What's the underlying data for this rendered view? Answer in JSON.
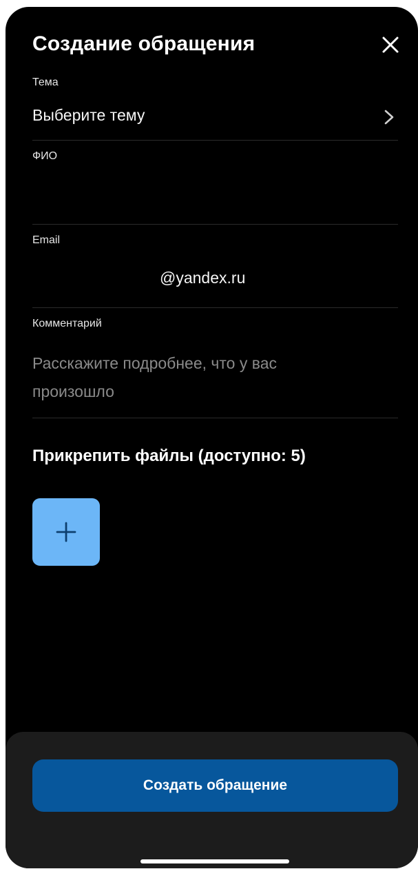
{
  "header": {
    "title": "Создание обращения",
    "close_icon": "close-icon"
  },
  "form": {
    "topic": {
      "label": "Тема",
      "value": "Выберите тему",
      "icon": "chevron-right-icon"
    },
    "name": {
      "label": "ФИО",
      "value": ""
    },
    "email": {
      "label": "Email",
      "value": "@yandex.ru"
    },
    "comment": {
      "label": "Комментарий",
      "placeholder": "Расскажите подробнее, что у вас произошло"
    }
  },
  "attachments": {
    "title": "Прикрепить файлы (доступно: 5)",
    "add_icon": "plus-icon"
  },
  "footer": {
    "submit_label": "Создать обращение"
  },
  "colors": {
    "background": "#000000",
    "accent_button": "#07579c",
    "add_tile": "#6cb6f7",
    "placeholder": "#8a8a8a",
    "divider": "#2b2b2b",
    "bottom_sheet": "#1c1c1c"
  }
}
